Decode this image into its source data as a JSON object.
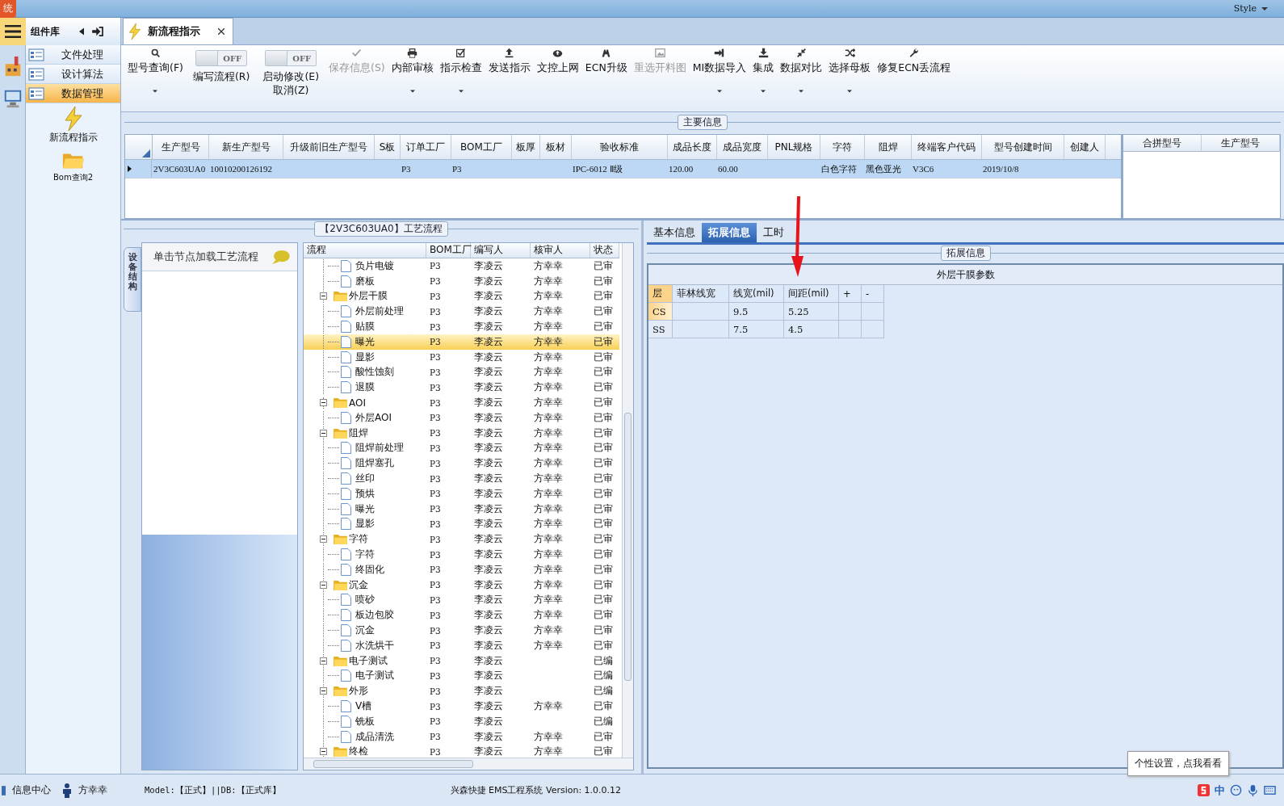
{
  "title_bar": {
    "system_button": "统",
    "style_menu": "Style"
  },
  "sidebar": {
    "title": "组件库",
    "items": [
      {
        "label": "文件处理",
        "selected": false
      },
      {
        "label": "设计算法",
        "selected": false
      },
      {
        "label": "数据管理",
        "selected": true
      }
    ],
    "shortcuts": [
      "新流程指示",
      "Bom查询2"
    ]
  },
  "document_tab": {
    "label": "新流程指示"
  },
  "toolbar": [
    {
      "kind": "button",
      "label": "型号查询(F)",
      "dropdown": true,
      "disabled": false
    },
    {
      "kind": "toggle",
      "state": "OFF",
      "on": false,
      "lines": [
        "编写流程(R)"
      ]
    },
    {
      "kind": "toggle",
      "state": "OFF",
      "on": false,
      "lines": [
        "启动修改(E)",
        "取消(Z)"
      ]
    },
    {
      "kind": "button",
      "label": "保存信息(S)",
      "dropdown": false,
      "disabled": true
    },
    {
      "kind": "button",
      "label": "内部审核",
      "dropdown": true,
      "disabled": false
    },
    {
      "kind": "button",
      "label": "指示检查",
      "dropdown": true,
      "disabled": false
    },
    {
      "kind": "button",
      "label": "发送指示",
      "dropdown": false,
      "disabled": false
    },
    {
      "kind": "button",
      "label": "文控上网",
      "dropdown": false,
      "disabled": false
    },
    {
      "kind": "button",
      "label": "ECN升级",
      "dropdown": false,
      "disabled": false
    },
    {
      "kind": "button",
      "label": "重选开料图",
      "dropdown": false,
      "disabled": true
    },
    {
      "kind": "button",
      "label": "MI数据导入",
      "dropdown": true,
      "disabled": false
    },
    {
      "kind": "button",
      "label": "集成",
      "dropdown": true,
      "disabled": false
    },
    {
      "kind": "button",
      "label": "数据对比",
      "dropdown": true,
      "disabled": false
    },
    {
      "kind": "button",
      "label": "选择母板",
      "dropdown": true,
      "disabled": false
    },
    {
      "kind": "button",
      "label": "修复ECN丢流程",
      "dropdown": false,
      "disabled": false
    }
  ],
  "main_info": {
    "title": "主要信息",
    "columns": [
      "生产型号",
      "新生产型号",
      "升级前旧生产型号",
      "S板",
      "订单工厂",
      "BOM工厂",
      "板厚",
      "板材",
      "验收标准",
      "成品长度",
      "成品宽度",
      "PNL规格",
      "字符",
      "阻焊",
      "终端客户代码",
      "型号创建时间",
      "创建人"
    ],
    "rows": [
      {
        "selected": true,
        "cells": [
          "2V3C603UA0",
          "10010200126192",
          null,
          null,
          "P3",
          "P3",
          null,
          null,
          "IPC-6012 Ⅱ级",
          "120.00",
          "60.00",
          null,
          "白色字符",
          "黑色亚光",
          "V3C6",
          "2019/10/8",
          null
        ]
      }
    ],
    "side_columns": [
      "合拼型号",
      "生产型号"
    ]
  },
  "process": {
    "title": "【2V3C603UA0】工艺流程",
    "side_tab": "设备结构",
    "hint": "单击节点加载工艺流程",
    "columns": [
      "流程",
      "BOM工厂",
      "编写人",
      "核审人",
      "状态"
    ],
    "tree": {
      "nodes": [
        {
          "kind": "leaf",
          "name": "负片电镀",
          "bom": "P3",
          "writer": "李凌云",
          "reviewer": "方幸幸",
          "status": "已审",
          "selected": false
        },
        {
          "kind": "leaf",
          "name": "磨板",
          "bom": "P3",
          "writer": "李凌云",
          "reviewer": "方幸幸",
          "status": "已审",
          "selected": false
        },
        {
          "kind": "folder",
          "name": "外层干膜",
          "bom": "P3",
          "writer": "李凌云",
          "reviewer": "方幸幸",
          "status": "已审",
          "selected": false,
          "expanded": true,
          "children": [
            {
              "kind": "leaf",
              "name": "外层前处理",
              "bom": "P3",
              "writer": "李凌云",
              "reviewer": "方幸幸",
              "status": "已审",
              "selected": false
            },
            {
              "kind": "leaf",
              "name": "贴膜",
              "bom": "P3",
              "writer": "李凌云",
              "reviewer": "方幸幸",
              "status": "已审",
              "selected": false
            },
            {
              "kind": "leaf",
              "name": "曝光",
              "bom": "P3",
              "writer": "李凌云",
              "reviewer": "方幸幸",
              "status": "已审",
              "selected": true
            },
            {
              "kind": "leaf",
              "name": "显影",
              "bom": "P3",
              "writer": "李凌云",
              "reviewer": "方幸幸",
              "status": "已审",
              "selected": false
            },
            {
              "kind": "leaf",
              "name": "酸性蚀刻",
              "bom": "P3",
              "writer": "李凌云",
              "reviewer": "方幸幸",
              "status": "已审",
              "selected": false
            },
            {
              "kind": "leaf",
              "name": "退膜",
              "bom": "P3",
              "writer": "李凌云",
              "reviewer": "方幸幸",
              "status": "已审",
              "selected": false
            }
          ]
        },
        {
          "kind": "folder",
          "name": "AOI",
          "bom": "P3",
          "writer": "李凌云",
          "reviewer": "方幸幸",
          "status": "已审",
          "selected": false,
          "expanded": true,
          "children": [
            {
              "kind": "leaf",
              "name": "外层AOI",
              "bom": "P3",
              "writer": "李凌云",
              "reviewer": "方幸幸",
              "status": "已审",
              "selected": false
            }
          ]
        },
        {
          "kind": "folder",
          "name": "阻焊",
          "bom": "P3",
          "writer": "李凌云",
          "reviewer": "方幸幸",
          "status": "已审",
          "selected": false,
          "expanded": true,
          "children": [
            {
              "kind": "leaf",
              "name": "阻焊前处理",
              "bom": "P3",
              "writer": "李凌云",
              "reviewer": "方幸幸",
              "status": "已审",
              "selected": false
            },
            {
              "kind": "leaf",
              "name": "阻焊塞孔",
              "bom": "P3",
              "writer": "李凌云",
              "reviewer": "方幸幸",
              "status": "已审",
              "selected": false
            },
            {
              "kind": "leaf",
              "name": "丝印",
              "bom": "P3",
              "writer": "李凌云",
              "reviewer": "方幸幸",
              "status": "已审",
              "selected": false
            },
            {
              "kind": "leaf",
              "name": "预烘",
              "bom": "P3",
              "writer": "李凌云",
              "reviewer": "方幸幸",
              "status": "已审",
              "selected": false
            },
            {
              "kind": "leaf",
              "name": "曝光",
              "bom": "P3",
              "writer": "李凌云",
              "reviewer": "方幸幸",
              "status": "已审",
              "selected": false
            },
            {
              "kind": "leaf",
              "name": "显影",
              "bom": "P3",
              "writer": "李凌云",
              "reviewer": "方幸幸",
              "status": "已审",
              "selected": false
            }
          ]
        },
        {
          "kind": "folder",
          "name": "字符",
          "bom": "P3",
          "writer": "李凌云",
          "reviewer": "方幸幸",
          "status": "已审",
          "selected": false,
          "expanded": true,
          "children": [
            {
              "kind": "leaf",
              "name": "字符",
              "bom": "P3",
              "writer": "李凌云",
              "reviewer": "方幸幸",
              "status": "已审",
              "selected": false
            },
            {
              "kind": "leaf",
              "name": "终固化",
              "bom": "P3",
              "writer": "李凌云",
              "reviewer": "方幸幸",
              "status": "已审",
              "selected": false
            }
          ]
        },
        {
          "kind": "folder",
          "name": "沉金",
          "bom": "P3",
          "writer": "李凌云",
          "reviewer": "方幸幸",
          "status": "已审",
          "selected": false,
          "expanded": true,
          "children": [
            {
              "kind": "leaf",
              "name": "喷砂",
              "bom": "P3",
              "writer": "李凌云",
              "reviewer": "方幸幸",
              "status": "已审",
              "selected": false
            },
            {
              "kind": "leaf",
              "name": "板边包胶",
              "bom": "P3",
              "writer": "李凌云",
              "reviewer": "方幸幸",
              "status": "已审",
              "selected": false
            },
            {
              "kind": "leaf",
              "name": "沉金",
              "bom": "P3",
              "writer": "李凌云",
              "reviewer": "方幸幸",
              "status": "已审",
              "selected": false
            },
            {
              "kind": "leaf",
              "name": "水洗烘干",
              "bom": "P3",
              "writer": "李凌云",
              "reviewer": "方幸幸",
              "status": "已审",
              "selected": false
            }
          ]
        },
        {
          "kind": "folder",
          "name": "电子测试",
          "bom": "P3",
          "writer": "李凌云",
          "status": "已编",
          "selected": false,
          "expanded": true,
          "children": [
            {
              "kind": "leaf",
              "name": "电子测试",
              "bom": "P3",
              "writer": "李凌云",
              "status": "已编",
              "selected": false
            }
          ]
        },
        {
          "kind": "folder",
          "name": "外形",
          "bom": "P3",
          "writer": "李凌云",
          "status": "已编",
          "selected": false,
          "expanded": true,
          "children": [
            {
              "kind": "leaf",
              "name": "V槽",
              "bom": "P3",
              "writer": "李凌云",
              "reviewer": "方幸幸",
              "status": "已审",
              "selected": false
            },
            {
              "kind": "leaf",
              "name": "铣板",
              "bom": "P3",
              "writer": "李凌云",
              "status": "已编",
              "selected": false
            },
            {
              "kind": "leaf",
              "name": "成品清洗",
              "bom": "P3",
              "writer": "李凌云",
              "reviewer": "方幸幸",
              "status": "已审",
              "selected": false
            }
          ]
        },
        {
          "kind": "folder",
          "name": "终检",
          "bom": "P3",
          "writer": "李凌云",
          "reviewer": "方幸幸",
          "status": "已审",
          "selected": false,
          "expanded": true
        }
      ]
    }
  },
  "detail": {
    "tabs": [
      {
        "label": "基本信息",
        "selected": false
      },
      {
        "label": "拓展信息",
        "selected": true
      },
      {
        "label": "工时",
        "selected": false
      }
    ],
    "group_title": "拓展信息",
    "grid_title": "外层干膜参数",
    "columns": [
      "层",
      "菲林线宽",
      "线宽(mil)",
      "间距(mil)",
      "+",
      "-"
    ],
    "rows": [
      {
        "selected": true,
        "cells": [
          "CS",
          null,
          "9.5",
          "5.25",
          null,
          null
        ]
      },
      {
        "selected": false,
        "cells": [
          "SS",
          null,
          "7.5",
          "4.5",
          null,
          null
        ]
      }
    ]
  },
  "status_bar": {
    "info_center": "信息中心",
    "user": "方幸幸",
    "environment": "Model:【正式】||DB:【正式库】",
    "product": "兴森快捷 EMS工程系统 Version: 1.0.0.12",
    "ime": "中"
  },
  "tooltip": "个性设置，点我看看"
}
